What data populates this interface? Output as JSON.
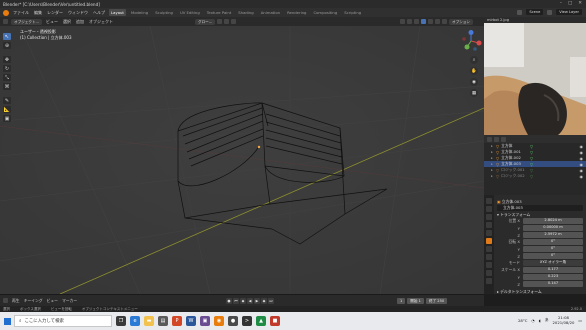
{
  "window": {
    "title": "Blender* [C:\\Users\\Blender\\Ver\\untitled.blend]",
    "controls": [
      "–",
      "□",
      "✕"
    ]
  },
  "menubar": {
    "items": [
      "ファイル",
      "編集",
      "レンダー",
      "ウィンドウ",
      "ヘルプ"
    ],
    "tabs": [
      "Layout",
      "Modeling",
      "Sculpting",
      "UV Editing",
      "Texture Paint",
      "Shading",
      "Animation",
      "Rendering",
      "Compositing",
      "Scripting"
    ],
    "active_tab": "Layout",
    "scene_label": "Scene",
    "view_layer_label": "View Layer"
  },
  "viewport_header": {
    "mode": "オブジェクト...",
    "menus": [
      "ビュー",
      "選択",
      "追加",
      "オブジェクト"
    ],
    "transform_orientation": "グロー...",
    "options_label": "オプション"
  },
  "viewport": {
    "info_line1": "ユーザー・透視投影",
    "info_line2": "(1) Collection | 立方体.003"
  },
  "webcam": {
    "label": "mirbot 2.jpg"
  },
  "outliner": {
    "rows": [
      {
        "label": "立方体",
        "selected": false,
        "dim": false,
        "mark": "▽"
      },
      {
        "label": "立方体.001",
        "selected": false,
        "dim": false,
        "mark": "▽"
      },
      {
        "label": "立方体.002",
        "selected": false,
        "dim": false,
        "mark": "▽"
      },
      {
        "label": "立方体.003",
        "selected": true,
        "dim": false,
        "mark": "▽"
      },
      {
        "label": "ロジック.001",
        "selected": false,
        "dim": true,
        "mark": "▽"
      },
      {
        "label": "ロジック.002",
        "selected": false,
        "dim": true,
        "mark": "▽"
      }
    ]
  },
  "properties": {
    "object_name": "立方体.003",
    "object_field": "立方体.003",
    "transform_title": "トランスフォーム",
    "location": {
      "label": "位置 X",
      "x": "2.8024 m",
      "y": "0.00000 m",
      "z": "2.5972 m"
    },
    "rotation": {
      "label": "回転 X",
      "x": "0°",
      "y": "0°",
      "z": "0°"
    },
    "mode": {
      "label": "モード",
      "value": "XYZ オイラー角"
    },
    "scale": {
      "label": "スケール X",
      "x": "0.177",
      "y": "0.223",
      "z": "0.147"
    },
    "delta_title": "デルタトランスフォーム",
    "axis_labels": {
      "y": "Y",
      "z": "Z"
    }
  },
  "timeline": {
    "menus": [
      "再生",
      "キーイング",
      "ビュー",
      "マーカー"
    ],
    "current_frame": "1",
    "start_label": "開始",
    "start": "1",
    "end_label": "終了",
    "end": "250"
  },
  "statusbar": {
    "items": [
      "選択",
      "ボックス選択",
      "ビューを回転",
      "オブジェクトコンテキストメニュー"
    ],
    "version": "2.92.0"
  },
  "taskbar": {
    "search_placeholder": "ここに入力して検索",
    "weather": "28°C",
    "clock_time": "21:08",
    "clock_date": "2021/08/20",
    "ime": "あ"
  },
  "colors": {
    "accent": "#4772b3",
    "object_orange": "#f29c38",
    "blender_orange": "#e87d0d"
  }
}
